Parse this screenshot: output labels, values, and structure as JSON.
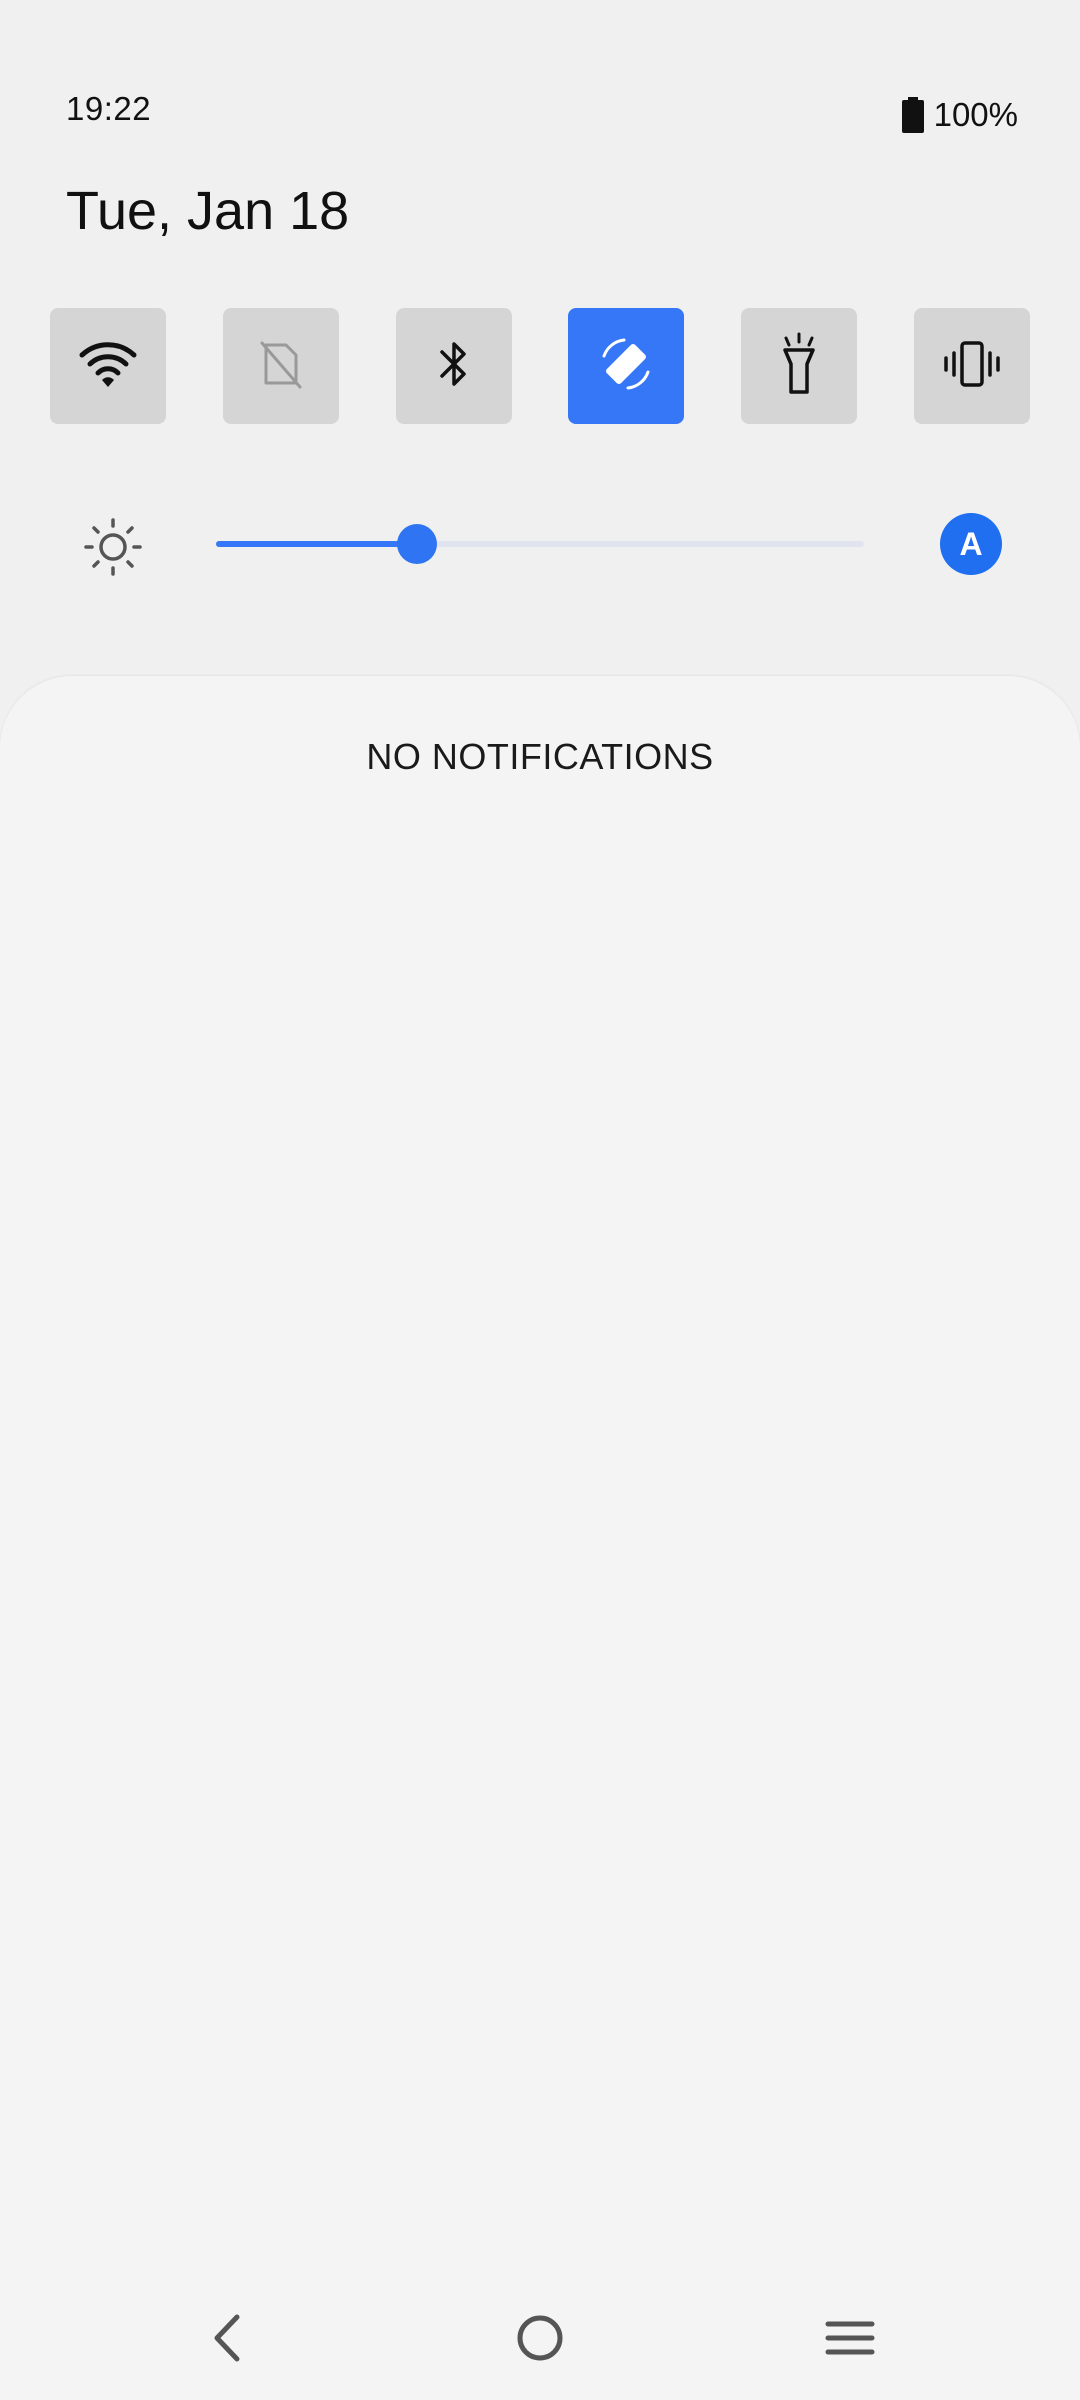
{
  "status_bar": {
    "time": "19:22",
    "battery_percent": "100%"
  },
  "header": {
    "date": "Tue, Jan 18"
  },
  "quick_tiles": [
    {
      "icon": "wifi-icon",
      "active": true
    },
    {
      "icon": "no-sim-icon",
      "active": false
    },
    {
      "icon": "bluetooth-icon",
      "active": false
    },
    {
      "icon": "auto-rotate-icon",
      "active": true
    },
    {
      "icon": "flashlight-icon",
      "active": false
    },
    {
      "icon": "vibrate-icon",
      "active": false
    }
  ],
  "brightness": {
    "level": 0.31,
    "auto_label": "A"
  },
  "notifications": {
    "empty_label": "NO NOTIFICATIONS"
  },
  "colors": {
    "accent": "#3577f7",
    "tile_bg": "#d5d5d5",
    "background": "#f0f0f0"
  }
}
